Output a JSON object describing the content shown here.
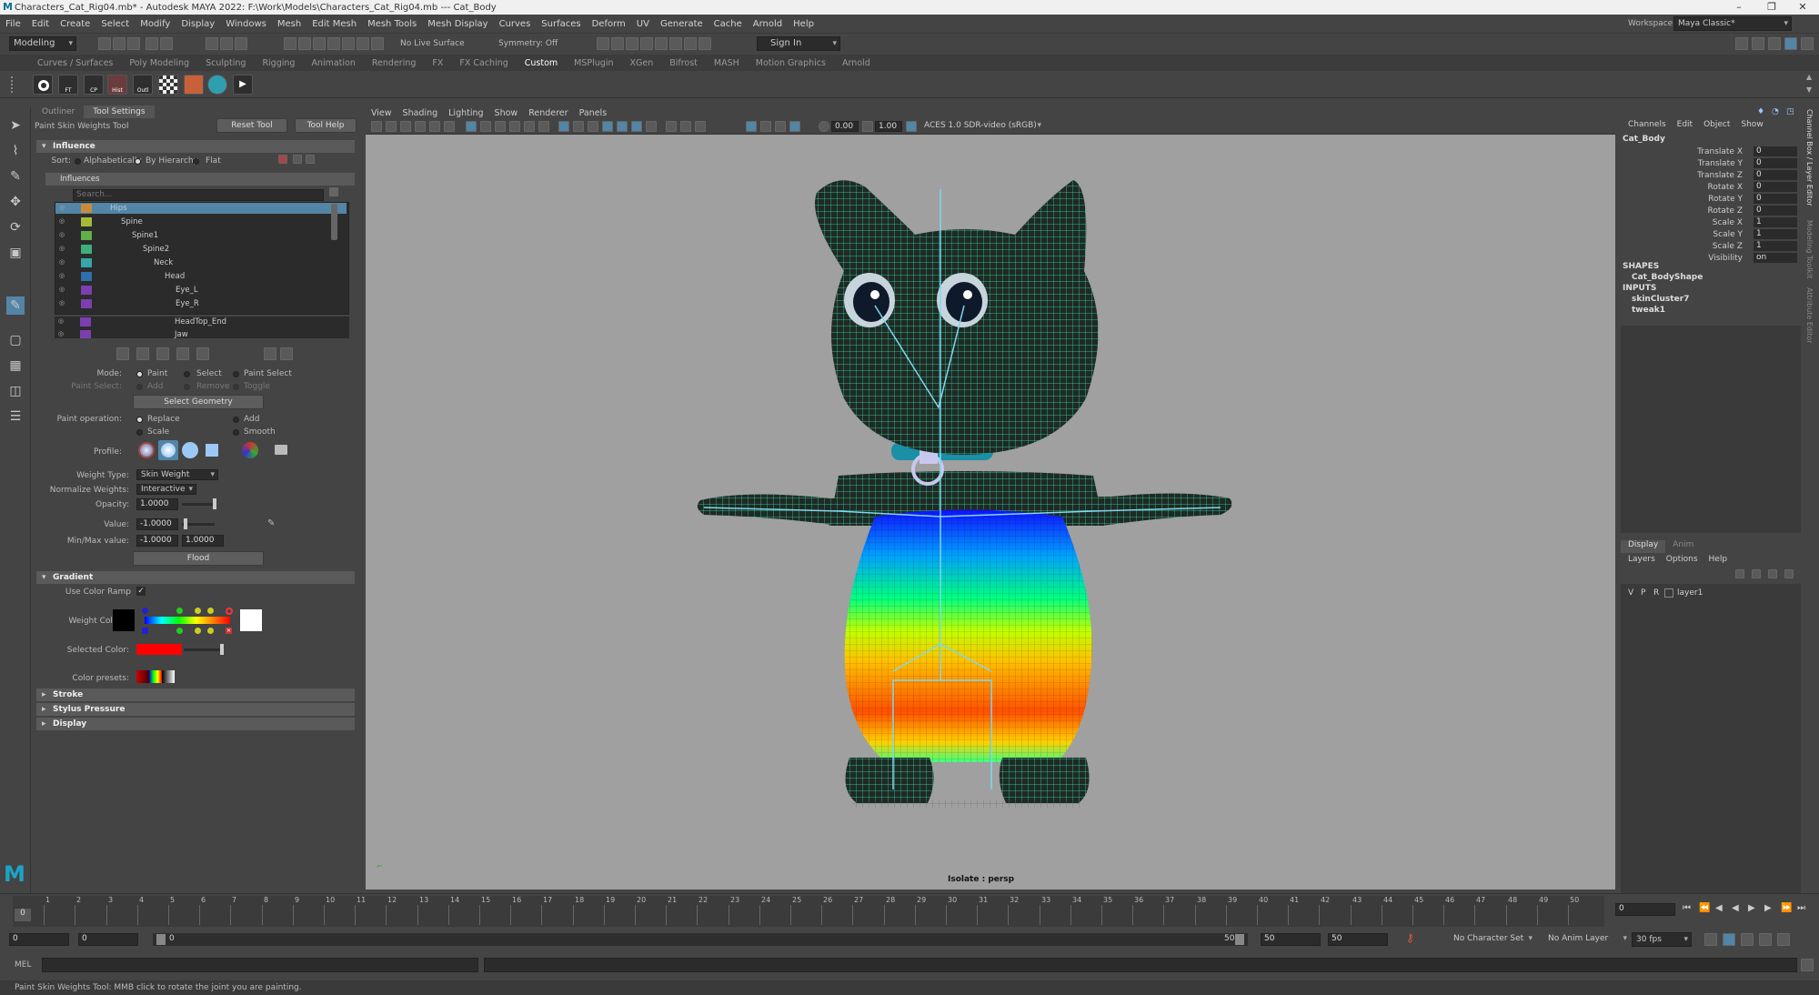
{
  "titlebar": {
    "title": "Characters_Cat_Rig04.mb* - Autodesk MAYA 2022: F:\\Work\\Models\\Characters_Cat_Rig04.mb  ---  Cat_Body",
    "minimize": "–",
    "maximize": "❐",
    "close": "✕"
  },
  "menubar": {
    "items": [
      "File",
      "Edit",
      "Create",
      "Select",
      "Modify",
      "Display",
      "Windows",
      "Mesh",
      "Edit Mesh",
      "Mesh Tools",
      "Mesh Display",
      "Curves",
      "Surfaces",
      "Deform",
      "UV",
      "Generate",
      "Cache",
      "Arnold",
      "Help"
    ],
    "workspace_label": "Workspace :",
    "workspace_value": "Maya Classic*"
  },
  "statusline": {
    "mode": "Modeling",
    "live_surface": "No Live Surface",
    "symmetry": "Symmetry: Off",
    "sign_in": "Sign In"
  },
  "shelf": {
    "tabs": [
      "Curves / Surfaces",
      "Poly Modeling",
      "Sculpting",
      "Rigging",
      "Animation",
      "Rendering",
      "FX",
      "FX Caching",
      "Custom",
      "MSPlugin",
      "XGen",
      "Bifrost",
      "MASH",
      "Motion Graphics",
      "Arnold"
    ],
    "active_tab": "Custom",
    "buttons": [
      {
        "label": "",
        "icon": "circle-icon"
      },
      {
        "label": "FT",
        "icon": "freeze-transform-icon"
      },
      {
        "label": "CP",
        "icon": "center-pivot-icon"
      },
      {
        "label": "Hist",
        "icon": "delete-history-icon"
      },
      {
        "label": "Outl",
        "icon": "outliner-icon"
      },
      {
        "label": "",
        "icon": "checker-icon"
      },
      {
        "label": "",
        "icon": "snapshot-icon"
      },
      {
        "label": "",
        "icon": "render-sphere-icon"
      },
      {
        "label": "",
        "icon": "playblast-icon"
      }
    ]
  },
  "left_panel": {
    "tabs": [
      "Outliner",
      "Tool Settings"
    ],
    "active_tab": "Tool Settings",
    "tool_name": "Paint Skin Weights Tool",
    "reset_tool": "Reset Tool",
    "tool_help": "Tool Help",
    "influence": {
      "header": "Influence",
      "sort_label": "Sort:",
      "sort_options": [
        "Alphabetically",
        "By Hierarchy",
        "Flat"
      ],
      "sort_selected": "By Hierarchy",
      "influences_header": "Influences",
      "search_placeholder": "Search...",
      "joints": [
        {
          "name": "Hips",
          "color": "#c98a3c",
          "selected": true
        },
        {
          "name": "Spine",
          "color": "#a7b93a"
        },
        {
          "name": "Spine1",
          "color": "#5fb04a"
        },
        {
          "name": "Spine2",
          "color": "#3fae7b"
        },
        {
          "name": "Neck",
          "color": "#36a6a6"
        },
        {
          "name": "Head",
          "color": "#2f6fae"
        },
        {
          "name": "Eye_L",
          "color": "#7c3fb0"
        },
        {
          "name": "Eye_R",
          "color": "#7c3fb0"
        },
        {
          "name": "HeadTop_End",
          "color": "#7c3fb0"
        },
        {
          "name": "Jaw",
          "color": "#7c3fb0"
        }
      ],
      "mode_label": "Mode:",
      "mode_options": [
        "Paint",
        "Select",
        "Paint Select"
      ],
      "mode_selected": "Paint",
      "paint_select_label": "Paint Select:",
      "paint_select_options": [
        "Add",
        "Remove",
        "Toggle"
      ],
      "select_geometry": "Select Geometry",
      "paint_operation_label": "Paint operation:",
      "paint_operations": [
        "Replace",
        "Add",
        "Scale",
        "Smooth"
      ],
      "paint_operation_selected": "Replace",
      "profile_label": "Profile:",
      "weight_type_label": "Weight Type:",
      "weight_type_value": "Skin Weight",
      "normalize_label": "Normalize Weights:",
      "normalize_value": "Interactive",
      "opacity_label": "Opacity:",
      "opacity_value": "1.0000",
      "opacity_level": 1.0,
      "value_label": "Value:",
      "value_value": "-1.0000",
      "minmax_label": "Min/Max value:",
      "min_value": "-1.0000",
      "max_value": "1.0000",
      "flood": "Flood"
    },
    "gradient": {
      "header": "Gradient",
      "use_color_ramp_label": "Use Color Ramp",
      "use_color_ramp": true,
      "weight_color_label": "Weight Color:",
      "selected_color_label": "Selected Color:",
      "selected_color": "#ff0000",
      "color_presets_label": "Color presets:"
    },
    "collapsed_sections": [
      "Stroke",
      "Stylus Pressure",
      "Display"
    ]
  },
  "viewport": {
    "menu": [
      "View",
      "Shading",
      "Lighting",
      "Show",
      "Renderer",
      "Panels"
    ],
    "exposure": "0.00",
    "gamma": "1.00",
    "color_space": "ACES 1.0 SDR-video (sRGB)",
    "camera_label": "Isolate : persp",
    "background": "#a0a0a0"
  },
  "channel_box": {
    "menu": [
      "Channels",
      "Edit",
      "Object",
      "Show"
    ],
    "object_name": "Cat_Body",
    "channels": [
      {
        "name": "Translate X",
        "value": "0"
      },
      {
        "name": "Translate Y",
        "value": "0"
      },
      {
        "name": "Translate Z",
        "value": "0"
      },
      {
        "name": "Rotate X",
        "value": "0"
      },
      {
        "name": "Rotate Y",
        "value": "0"
      },
      {
        "name": "Rotate Z",
        "value": "0"
      },
      {
        "name": "Scale X",
        "value": "1"
      },
      {
        "name": "Scale Y",
        "value": "1"
      },
      {
        "name": "Scale Z",
        "value": "1"
      },
      {
        "name": "Visibility",
        "value": "on"
      }
    ],
    "shapes_header": "SHAPES",
    "shape_name": "Cat_BodyShape",
    "inputs_header": "INPUTS",
    "inputs": [
      "skinCluster7",
      "tweak1"
    ]
  },
  "layer_editor": {
    "tabs": [
      "Display",
      "Anim"
    ],
    "menu": [
      "Layers",
      "Options",
      "Help"
    ],
    "layer": {
      "v": "V",
      "p": "P",
      "r": "R",
      "name": "layer1"
    }
  },
  "right_strip_tabs": [
    "Channel Box / Layer Editor",
    "Modeling Toolkit",
    "Attribute Editor"
  ],
  "timeline": {
    "ticks": [
      "1",
      "2",
      "3",
      "4",
      "5",
      "6",
      "7",
      "8",
      "9",
      "10",
      "11",
      "12",
      "13",
      "14",
      "15",
      "16",
      "17",
      "18",
      "19",
      "20",
      "21",
      "22",
      "23",
      "24",
      "25",
      "26",
      "27",
      "28",
      "29",
      "30",
      "31",
      "32",
      "33",
      "34",
      "35",
      "36",
      "37",
      "38",
      "39",
      "40",
      "41",
      "42",
      "43",
      "44",
      "45",
      "46",
      "47",
      "48",
      "49",
      "50"
    ],
    "current_frame": "0",
    "current_frame_field": "0"
  },
  "range": {
    "start": "0",
    "playback_start": "0",
    "slider_start": "0",
    "slider_end": "50",
    "playback_end": "50",
    "end": "50",
    "character_set": "No Character Set",
    "anim_layer": "No Anim Layer",
    "fps": "30 fps"
  },
  "command_line": {
    "label": "MEL"
  },
  "help_line": {
    "text": "Paint Skin Weights Tool: MMB click to rotate the joint you are painting."
  }
}
